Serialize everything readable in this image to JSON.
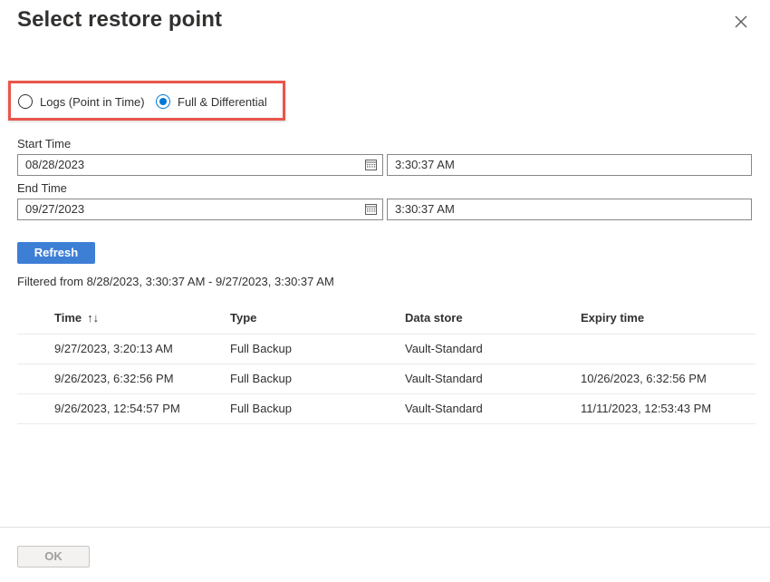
{
  "dialog": {
    "title": "Select restore point",
    "close_icon": "close-icon"
  },
  "restore_type": {
    "options": [
      {
        "label": "Logs (Point in Time)",
        "selected": false
      },
      {
        "label": "Full & Differential",
        "selected": true
      }
    ],
    "highlight_color": "#e8564b",
    "accent_color": "#0078d4"
  },
  "start": {
    "label": "Start Time",
    "date": "08/28/2023",
    "time": "3:30:37 AM"
  },
  "end": {
    "label": "End Time",
    "date": "09/27/2023",
    "time": "3:30:37 AM"
  },
  "refresh": {
    "label": "Refresh",
    "color": "#3e7fd6"
  },
  "filter_text": "Filtered from 8/28/2023, 3:30:37 AM - 9/27/2023, 3:30:37 AM",
  "table": {
    "columns": [
      "Time",
      "Type",
      "Data store",
      "Expiry time"
    ],
    "sort_icon": "↑↓",
    "rows": [
      [
        "9/27/2023, 3:20:13 AM",
        "Full Backup",
        "Vault-Standard",
        ""
      ],
      [
        "9/26/2023, 6:32:56 PM",
        "Full Backup",
        "Vault-Standard",
        "10/26/2023, 6:32:56 PM"
      ],
      [
        "9/26/2023, 12:54:57 PM",
        "Full Backup",
        "Vault-Standard",
        "11/11/2023, 12:53:43 PM"
      ]
    ]
  },
  "footer": {
    "ok_label": "OK"
  }
}
